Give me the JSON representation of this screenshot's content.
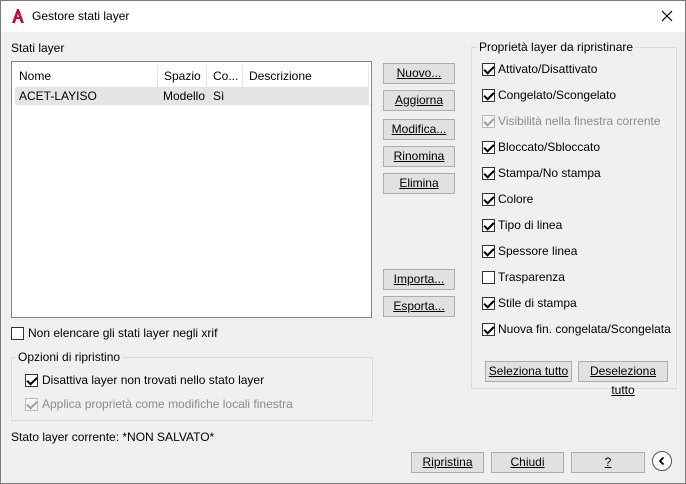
{
  "window": {
    "title": "Gestore stati layer",
    "close_icon": "close-icon",
    "app_icon": "autocad-icon"
  },
  "layer_states": {
    "label": "Stati layer",
    "columns": [
      "Nome",
      "Spazio",
      "Co...",
      "Descrizione"
    ],
    "rows": [
      {
        "nome": "ACET-LAYISO",
        "spazio": "Modello",
        "co": "Sì",
        "descrizione": ""
      }
    ]
  },
  "buttons": {
    "nuovo": "Nuovo...",
    "aggiorna": "Aggiorna",
    "modifica": "Modifica...",
    "rinomina": "Rinomina",
    "elimina": "Elimina",
    "importa": "Importa...",
    "esporta": "Esporta...",
    "seleziona_tutto": "Seleziona tutto",
    "deseleziona_tutto": "Deseleziona tutto",
    "ripristina": "Ripristina",
    "chiudi": "Chiudi",
    "help": "?"
  },
  "xref_option": {
    "label": "Non elencare gli stati layer negli xrif",
    "checked": false
  },
  "restore_options": {
    "title": "Opzioni di ripristino",
    "items": [
      {
        "label": "Disattiva layer non trovati nello stato layer",
        "checked": true,
        "enabled": true
      },
      {
        "label": "Applica proprietà come modifiche locali finestra",
        "checked": true,
        "enabled": false
      }
    ]
  },
  "properties": {
    "title": "Proprietà layer da ripristinare",
    "items": [
      {
        "label": "Attivato/Disattivato",
        "checked": true,
        "enabled": true
      },
      {
        "label": "Congelato/Scongelato",
        "checked": true,
        "enabled": true
      },
      {
        "label": "Visibilità nella finestra corrente",
        "checked": true,
        "enabled": false
      },
      {
        "label": "Bloccato/Sbloccato",
        "checked": true,
        "enabled": true
      },
      {
        "label": "Stampa/No stampa",
        "checked": true,
        "enabled": true
      },
      {
        "label": "Colore",
        "checked": true,
        "enabled": true
      },
      {
        "label": "Tipo di linea",
        "checked": true,
        "enabled": true
      },
      {
        "label": "Spessore linea",
        "checked": true,
        "enabled": true
      },
      {
        "label": "Trasparenza",
        "checked": false,
        "enabled": true
      },
      {
        "label": "Stile di stampa",
        "checked": true,
        "enabled": true
      },
      {
        "label": "Nuova fin. congelata/Scongelata",
        "checked": true,
        "enabled": true
      }
    ]
  },
  "status": {
    "current_state": "Stato layer corrente: *NON SALVATO*"
  },
  "colors": {
    "accent": "#c8102e",
    "selection": "#e5e5e5"
  }
}
